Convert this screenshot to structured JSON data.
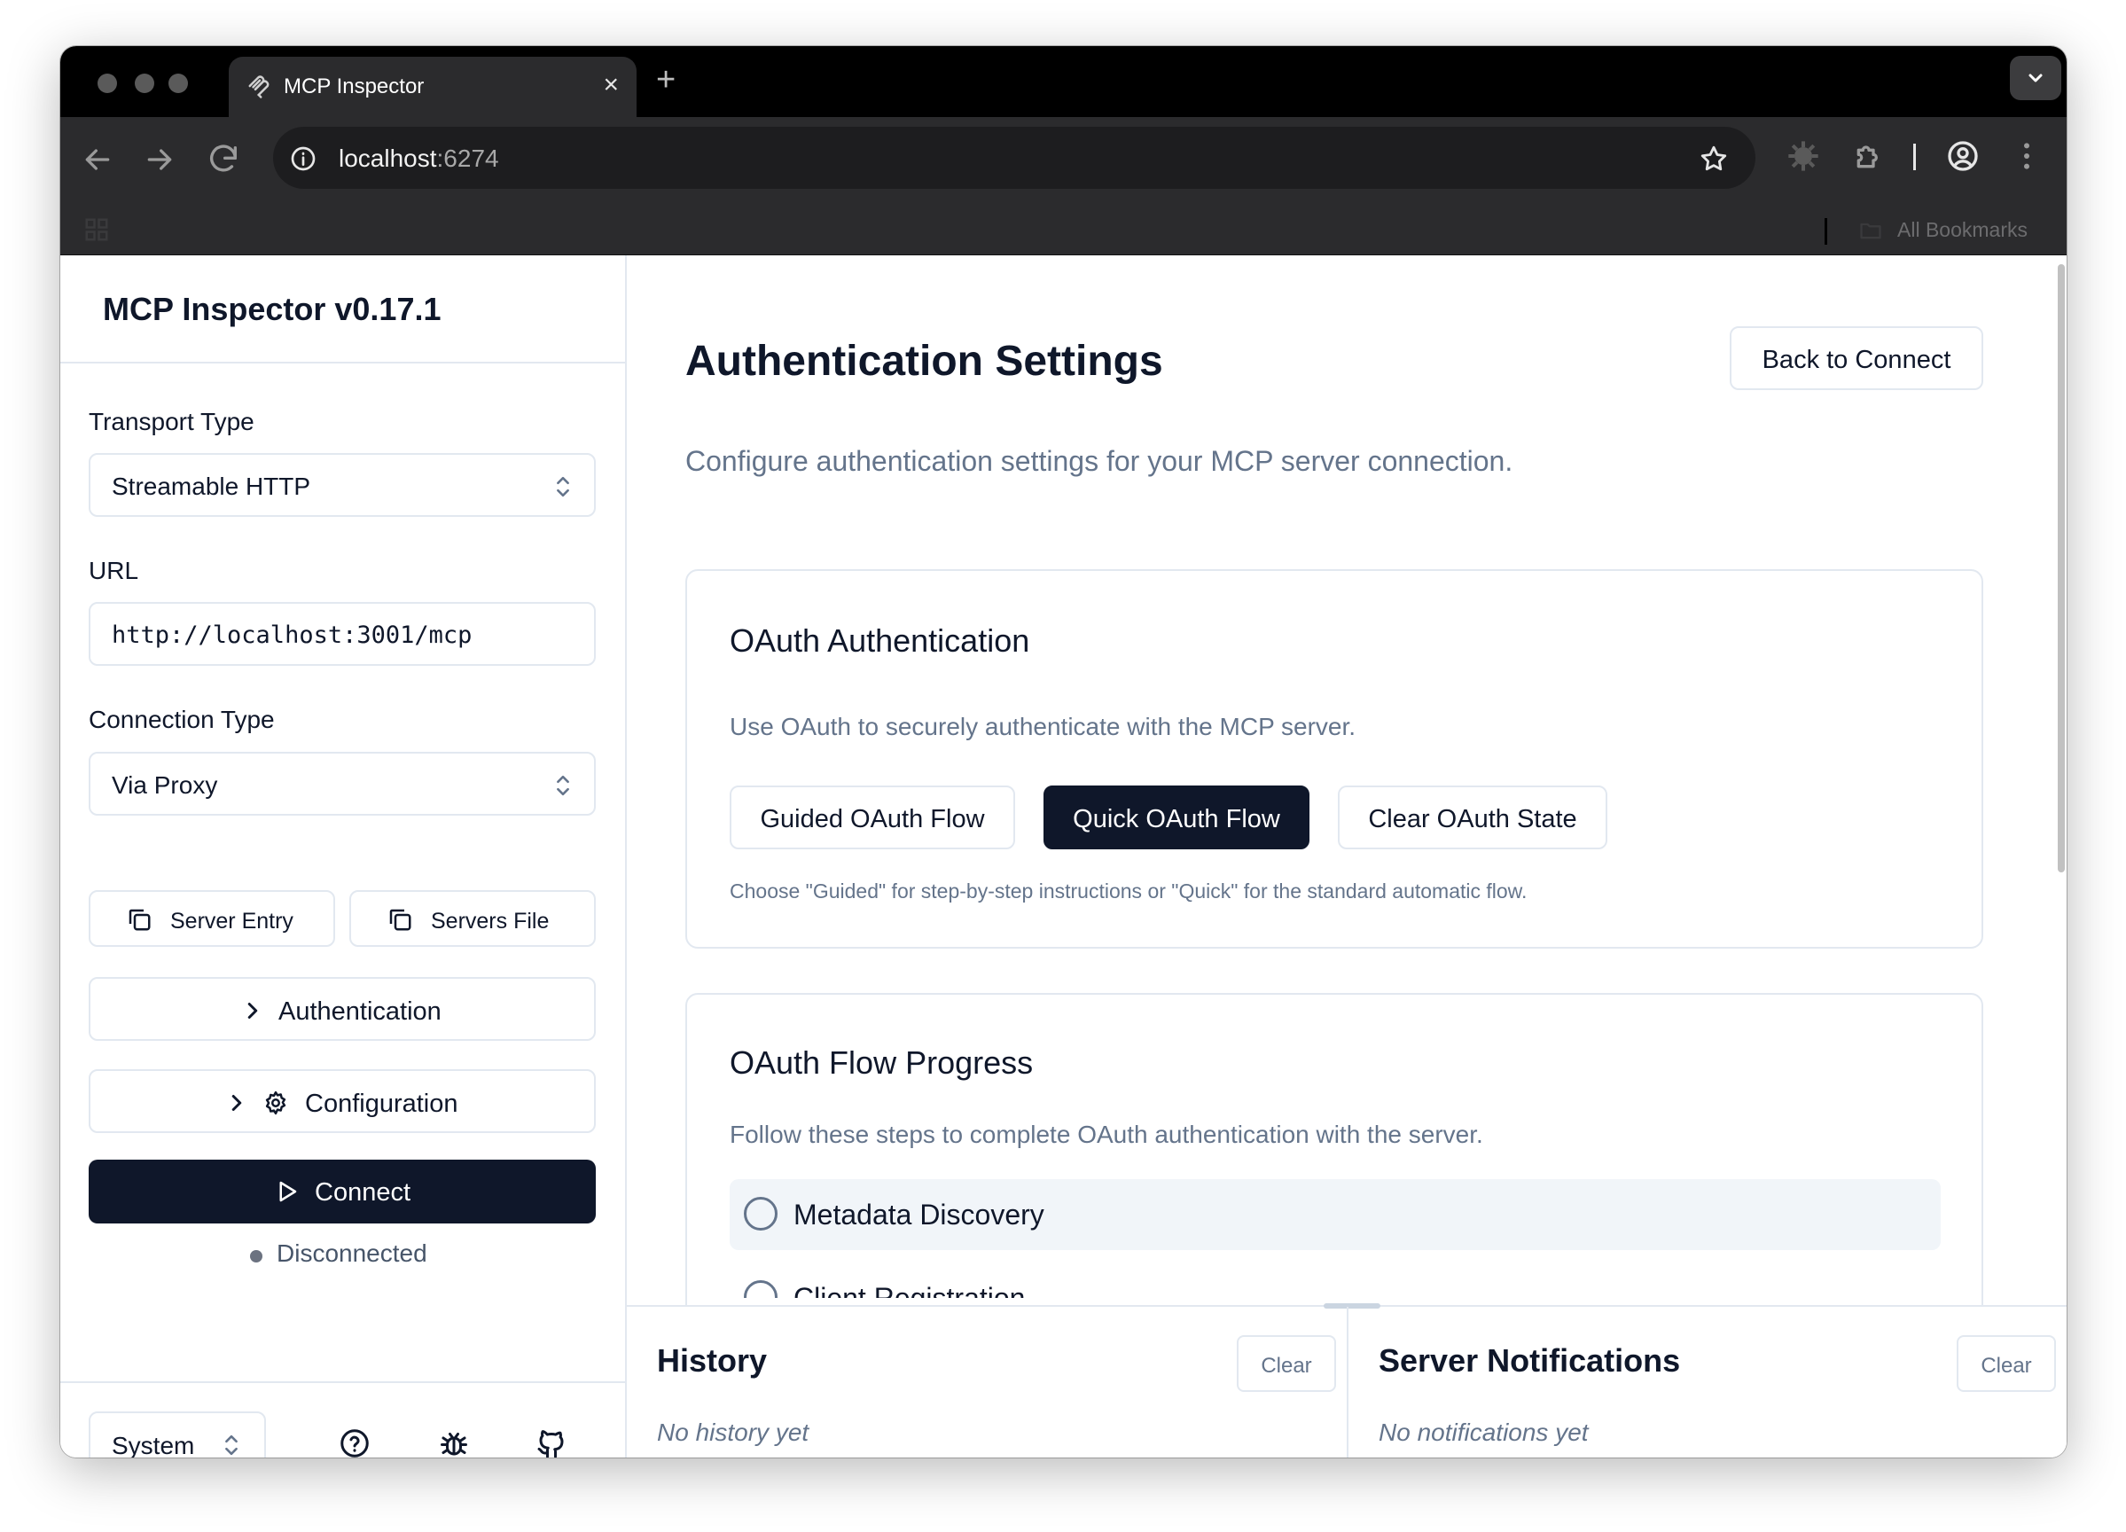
{
  "browser": {
    "tab_title": "MCP Inspector",
    "url_host": "localhost",
    "url_port": ":6274",
    "bookmarks_label": "All Bookmarks"
  },
  "sidebar": {
    "app_title": "MCP Inspector v0.17.1",
    "transport_label": "Transport Type",
    "transport_value": "Streamable HTTP",
    "url_label": "URL",
    "url_value": "http://localhost:3001/mcp",
    "connection_label": "Connection Type",
    "connection_value": "Via Proxy",
    "server_entry_label": "Server Entry",
    "servers_file_label": "Servers File",
    "authentication_label": "Authentication",
    "configuration_label": "Configuration",
    "connect_label": "Connect",
    "status_text": "Disconnected",
    "theme_value": "System"
  },
  "main": {
    "title": "Authentication Settings",
    "back_label": "Back to Connect",
    "subtitle": "Configure authentication settings for your MCP server connection.",
    "oauth_card": {
      "title": "OAuth Authentication",
      "description": "Use OAuth to securely authenticate with the MCP server.",
      "guided_label": "Guided OAuth Flow",
      "quick_label": "Quick OAuth Flow",
      "clear_label": "Clear OAuth State",
      "hint": "Choose \"Guided\" for step-by-step instructions or \"Quick\" for the standard automatic flow."
    },
    "progress_card": {
      "title": "OAuth Flow Progress",
      "description": "Follow these steps to complete OAuth authentication with the server.",
      "steps": [
        "Metadata Discovery",
        "Client Registration"
      ]
    }
  },
  "history": {
    "title": "History",
    "clear_label": "Clear",
    "empty_text": "No history yet"
  },
  "notifications": {
    "title": "Server Notifications",
    "clear_label": "Clear",
    "empty_text": "No notifications yet"
  },
  "colors": {
    "primary": "#0f172a",
    "border": "#e2e8f0",
    "muted_text": "#64748b",
    "step_bg": "#f1f5f9"
  },
  "icons": [
    "mcp-logo-icon",
    "close-icon",
    "plus-icon",
    "chevron-down-icon",
    "back-arrow-icon",
    "forward-arrow-icon",
    "reload-icon",
    "site-info-icon",
    "star-icon",
    "extension-icon",
    "puzzle-icon",
    "profile-icon",
    "more-vert-icon",
    "apps-icon",
    "folder-icon",
    "copy-icon",
    "chevron-right-icon",
    "gear-icon",
    "play-icon",
    "help-icon",
    "bug-icon",
    "github-icon"
  ]
}
